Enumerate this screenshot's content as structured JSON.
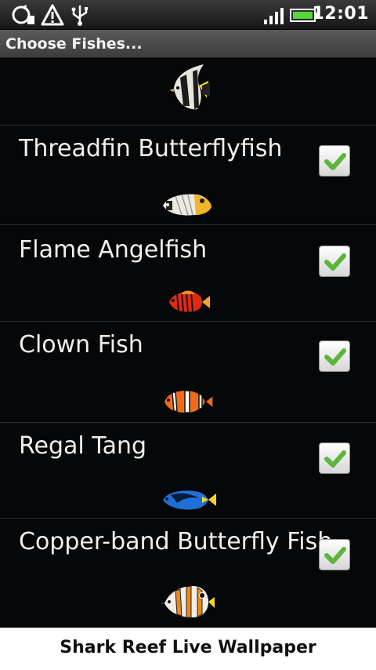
{
  "status_bar": {
    "time": "12:01",
    "icons": [
      "sync-icon",
      "warning-icon",
      "usb-icon",
      "signal-icon",
      "battery-icon"
    ]
  },
  "title": "Choose Fishes...",
  "list": {
    "items": [
      {
        "label": "",
        "fish_icon": "moorish-idol-fish-icon",
        "checked": null
      },
      {
        "label": "Threadfin Butterflyfish",
        "fish_icon": "threadfin-butterflyfish-icon",
        "checked": true
      },
      {
        "label": "Flame Angelfish",
        "fish_icon": "flame-angelfish-icon",
        "checked": true
      },
      {
        "label": "Clown Fish",
        "fish_icon": "clown-fish-icon",
        "checked": true
      },
      {
        "label": "Regal Tang",
        "fish_icon": "regal-tang-icon",
        "checked": true
      },
      {
        "label": "Copper-band Butterfly Fish",
        "fish_icon": "copper-band-butterfly-fish-icon",
        "checked": true
      }
    ]
  },
  "footer": {
    "text": "Shark Reef Live Wallpaper"
  },
  "colors": {
    "check_green": "#5db53b",
    "list_background": "#060708",
    "divider": "#2b2b2b"
  }
}
